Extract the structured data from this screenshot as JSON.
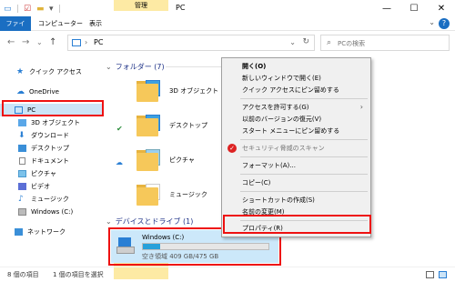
{
  "window": {
    "title": "PC",
    "context_tab_group": "管理",
    "controls": {
      "minimize": "—",
      "maximize": "☐",
      "close": "✕"
    }
  },
  "ribbon": {
    "tabs": [
      {
        "label": "ファイル"
      },
      {
        "label": "コンピューター"
      },
      {
        "label": "表示"
      },
      {
        "label": "ドライブ ツール"
      }
    ]
  },
  "address": {
    "path": "PC",
    "search_placeholder": "PCの検索"
  },
  "sidebar": {
    "items": [
      {
        "label": "クイック アクセス"
      },
      {
        "label": "OneDrive"
      },
      {
        "label": "PC"
      },
      {
        "label": "3D オブジェクト"
      },
      {
        "label": "ダウンロード"
      },
      {
        "label": "デスクトップ"
      },
      {
        "label": "ドキュメント"
      },
      {
        "label": "ピクチャ"
      },
      {
        "label": "ビデオ"
      },
      {
        "label": "ミュージック"
      },
      {
        "label": "Windows (C:)"
      },
      {
        "label": "ネットワーク"
      }
    ]
  },
  "main": {
    "folders_header": "フォルダー (7)",
    "folders": [
      {
        "label": "3D オブジェクト"
      },
      {
        "label": "デスクトップ"
      },
      {
        "label": "ピクチャ"
      },
      {
        "label": "ミュージック"
      }
    ],
    "devices_header": "デバイスとドライブ (1)",
    "drive": {
      "name": "Windows (C:)",
      "size_text": "空き領域 409 GB/475 GB",
      "used_fraction": 0.14
    }
  },
  "context_menu": {
    "items": [
      {
        "label": "開く(O)"
      },
      {
        "label": "新しいウィンドウで開く(E)"
      },
      {
        "label": "クイック アクセスにピン留めする"
      },
      {
        "label": "アクセスを許可する(G)"
      },
      {
        "label": "以前のバージョンの復元(V)"
      },
      {
        "label": "スタート メニューにピン留めする"
      },
      {
        "label": "セキュリティ脅威のスキャン"
      },
      {
        "label": "フォーマット(A)..."
      },
      {
        "label": "コピー(C)"
      },
      {
        "label": "ショートカットの作成(S)"
      },
      {
        "label": "名前の変更(M)"
      },
      {
        "label": "プロパティ(R)"
      }
    ]
  },
  "status": {
    "item_count": "8 個の項目",
    "selected_count": "1 個の項目を選択"
  },
  "colors": {
    "accent": "#1a6ec2",
    "highlight": "#e11111",
    "selection": "#cce4f7",
    "drive_tool": "#fdeaa4"
  }
}
